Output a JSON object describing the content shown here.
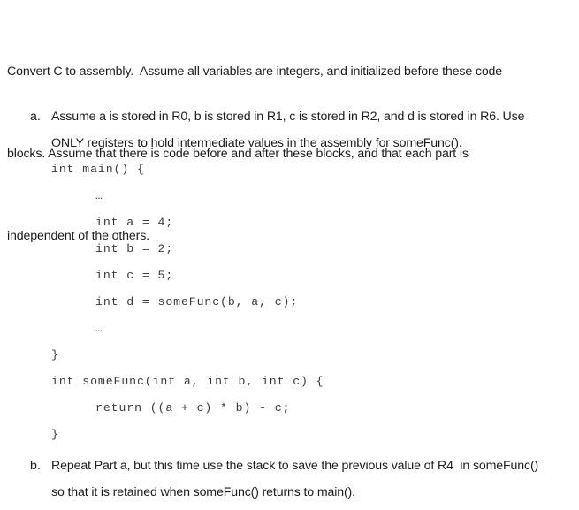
{
  "document": {
    "intro": {
      "lines": [
        "Convert C to assembly.  Assume all variables are integers, and initialized before these code",
        "blocks. Assume that there is code before and after these blocks, and that each part is",
        "independent of the others."
      ]
    },
    "list": [
      {
        "marker": "a.",
        "text_lines": [
          "Assume a is stored in R0, b is stored in R1, c is stored in R2, and d is stored in R6. Use",
          "ONLY registers to hold intermediate values in the assembly for someFunc()."
        ],
        "code_lines": [
          {
            "indent": 0,
            "text": "int main() {"
          },
          {
            "indent": 1,
            "text": "…"
          },
          {
            "indent": 1,
            "text": "int a = 4;"
          },
          {
            "indent": 1,
            "text": "int b = 2;"
          },
          {
            "indent": 1,
            "text": "int c = 5;"
          },
          {
            "indent": 1,
            "text": "int d = someFunc(b, a, c);"
          },
          {
            "indent": 1,
            "text": "…"
          },
          {
            "indent": 0,
            "text": "}"
          },
          {
            "indent": 0,
            "text": "int someFunc(int a, int b, int c) {"
          },
          {
            "indent": 1,
            "text": "return ((a + c) * b) - c;"
          },
          {
            "indent": 0,
            "text": "}"
          }
        ]
      },
      {
        "marker": "b.",
        "text_lines": [
          "Repeat Part a, but this time use the stack to save the previous value of R4  in someFunc()",
          "so that it is retained when someFunc() returns to main()."
        ],
        "code_lines": []
      }
    ],
    "colors": {
      "background": "#ffffff",
      "body_text": "#1c1c1c",
      "code_text": "#3a3a3a"
    }
  }
}
